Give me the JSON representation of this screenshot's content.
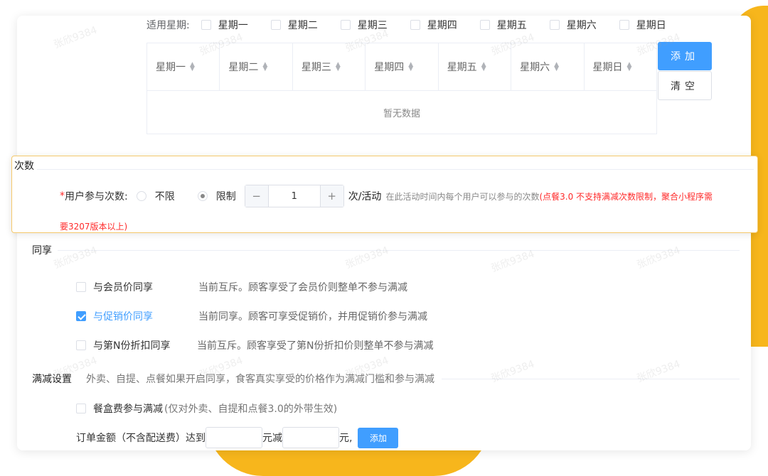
{
  "weekdays": {
    "label": "适用星期:",
    "days": [
      "星期一",
      "星期二",
      "星期三",
      "星期四",
      "星期五",
      "星期六",
      "星期日"
    ]
  },
  "table": {
    "columns": [
      "星期一",
      "星期二",
      "星期三",
      "星期四",
      "星期五",
      "星期六",
      "星期日"
    ],
    "empty_text": "暂无数据"
  },
  "buttons": {
    "add": "添加",
    "clear": "清空",
    "add_small": "添加"
  },
  "times": {
    "title": "次数",
    "required_mark": "*",
    "field_label": "用户参与次数:",
    "option_unlimited": "不限",
    "option_limited": "限制",
    "selected": "限制",
    "stepper_minus": "−",
    "stepper_value": "1",
    "stepper_plus": "+",
    "unit": "次/活动",
    "hint": "在此活动时间内每个用户可以参与的次数",
    "warning_line1": "(点餐3.0 不支持满减次数限制，聚合小程序需",
    "warning_line2": "要3207版本以上)"
  },
  "share": {
    "title": "同享",
    "items": [
      {
        "label": "与会员价同享",
        "checked": false,
        "desc": "当前互斥。顾客享受了会员价则整单不参与满减"
      },
      {
        "label": "与促销价同享",
        "checked": true,
        "desc": "当前同享。顾客可享受促销价，并用促销价参与满减"
      },
      {
        "label": "与第N份折扣同享",
        "checked": false,
        "desc": "当前互斥。顾客享受了第N份折扣价则整单不参与满减"
      }
    ]
  },
  "fullreduce": {
    "title": "满减设置",
    "desc": "外卖、自提、点餐如果开启同享，食客真实享受的价格作为满减门槛和参与满减",
    "box_fee_label": "餐盒费参与满减",
    "box_fee_note": "(仅对外卖、自提和点餐3.0的外带生效)",
    "box_fee_checked": false,
    "order_label": "订单金额（不含配送费）达到",
    "unit_reduce": "元减",
    "unit_end": "元,"
  },
  "watermark": "张欣9384",
  "colors": {
    "primary": "#409eff",
    "warning": "#ff2a2a",
    "accent_yellow": "#f7b61c"
  }
}
